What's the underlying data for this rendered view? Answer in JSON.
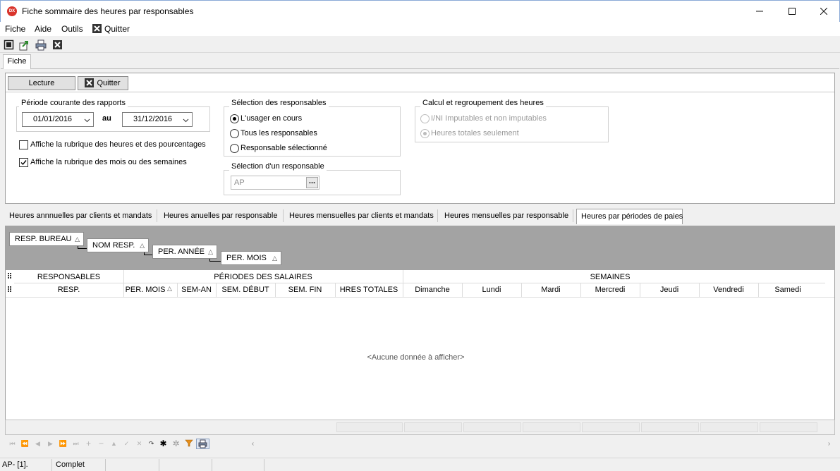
{
  "window": {
    "app_icon_text": "DX",
    "title": "Fiche sommaire des heures par responsables"
  },
  "menu": {
    "items": [
      "Fiche",
      "Aide",
      "Outils",
      "Quitter"
    ]
  },
  "toolbar_icons": [
    "window-icon",
    "export-icon",
    "print-icon",
    "close-icon"
  ],
  "fiche_tab": "Fiche",
  "panel": {
    "read_button": "Lecture",
    "quit_button": "Quitter",
    "period_group": {
      "title": "Période courante des rapports",
      "from_date": "01/01/2016",
      "between_label": "au",
      "to_date": "31/12/2016"
    },
    "checkboxes": [
      {
        "label": "Affiche la rubrique des heures et des pourcentages",
        "checked": false
      },
      {
        "label": "Affiche la rubrique des mois ou des semaines",
        "checked": true
      }
    ],
    "responsables_group": {
      "title": "Sélection des responsables",
      "options": [
        {
          "label": "L'usager en cours",
          "selected": true
        },
        {
          "label": "Tous les responsables",
          "selected": false
        },
        {
          "label": "Responsable sélectionné",
          "selected": false
        }
      ]
    },
    "single_group": {
      "title": "Sélection d'un responsable",
      "value": "AP",
      "lookup_button": "..."
    },
    "calc_group": {
      "title": "Calcul et regroupement des heures",
      "options": [
        {
          "label": "I/NI Imputables et non imputables",
          "selected": false
        },
        {
          "label": "Heures totales seulement",
          "selected": true
        }
      ]
    }
  },
  "tabs": [
    "Heures annnuelles par clients et mandats",
    "Heures anuelles par responsable",
    "Heures mensuelles par clients et mandats",
    "Heures mensuelles par responsable",
    "Heures par périodes de paies"
  ],
  "group_chips": [
    "RESP. BUREAU",
    "NOM RESP.",
    "PER. ANNÉE",
    "PER. MOIS"
  ],
  "grid": {
    "bands": [
      "RESPONSABLES",
      "PÉRIODES DES SALAIRES",
      "SEMAINES"
    ],
    "columns": [
      "RESP.",
      "PER. MOIS",
      "SEM-AN",
      "SEM. DÉBUT",
      "SEM. FIN",
      "HRES TOTALES",
      "Dimanche",
      "Lundi",
      "Mardi",
      "Mercredi",
      "Jeudi",
      "Vendredi",
      "Samedi"
    ],
    "sort_glyph": "△",
    "empty_text": "<Aucune donnée à afficher>"
  },
  "status": {
    "cells": [
      "AP- [1].",
      "Complet"
    ]
  }
}
